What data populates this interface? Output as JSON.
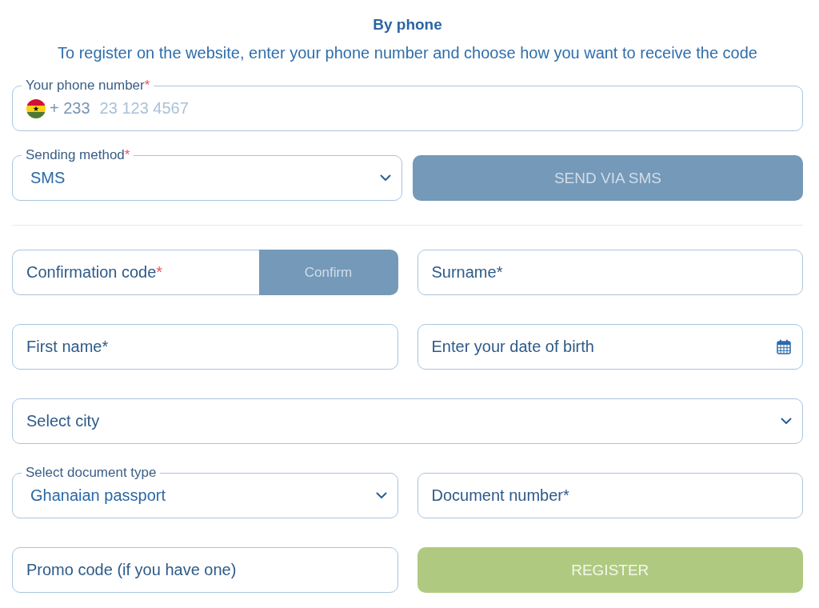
{
  "heading": "By phone",
  "instructions": "To register on the website, enter your phone number and choose how you want to receive the code",
  "phone": {
    "label": "Your phone number",
    "required_mark": "*",
    "country_code": "+ 233",
    "placeholder": "23 123 4567"
  },
  "sending": {
    "method": {
      "label": "Sending method",
      "required_mark": "*",
      "value": "SMS"
    },
    "button": {
      "label": "SEND VIA SMS",
      "disabled": true
    }
  },
  "rows": [
    [
      {
        "kind": "code",
        "label": "Confirmation code",
        "required_mark": "*",
        "button": {
          "label": "Confirm",
          "disabled": true
        }
      },
      {
        "kind": "text",
        "label": "Surname*"
      }
    ],
    [
      {
        "kind": "text",
        "label": "First name*"
      },
      {
        "kind": "date",
        "label": "Enter your date of birth"
      }
    ],
    [
      {
        "kind": "select",
        "label": "Select city"
      }
    ],
    [
      {
        "kind": "select",
        "label": "Select document type",
        "value": "Ghanaian passport"
      },
      {
        "kind": "text",
        "label": "Document number*"
      }
    ],
    [
      {
        "kind": "text",
        "label": "Promo code (if you have one)"
      },
      {
        "kind": "button",
        "label": "REGISTER",
        "disabled": true
      }
    ]
  ]
}
